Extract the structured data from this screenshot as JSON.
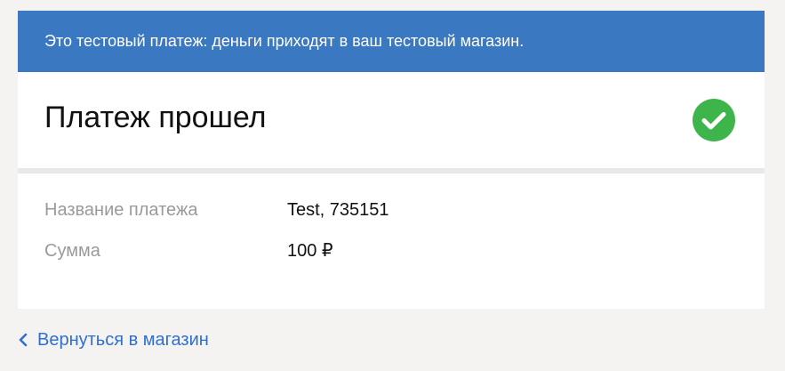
{
  "banner": {
    "text": "Это тестовый платеж: деньги приходят в ваш тестовый магазин.",
    "color": "#3b78c2"
  },
  "status": {
    "title": "Платеж прошел",
    "icon": "check-circle-icon",
    "icon_color": "#3db54a"
  },
  "details": [
    {
      "label": "Название платежа",
      "value": "Test, 735151"
    },
    {
      "label": "Сумма",
      "value": "100 ₽"
    }
  ],
  "back_link": {
    "label": "Вернуться в магазин",
    "icon": "chevron-left-icon",
    "color": "#2f6fd1"
  }
}
